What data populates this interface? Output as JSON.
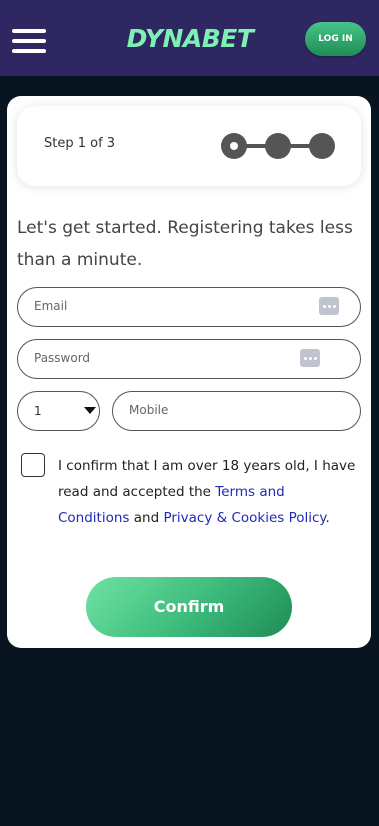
{
  "header": {
    "logo_text": "DYNABET",
    "login_label": "LOG IN"
  },
  "step": {
    "label": "Step 1 of 3",
    "current": 1,
    "total": 3
  },
  "intro_text": "Let's get started. Registering takes less than a minute.",
  "form": {
    "email_placeholder": "Email",
    "password_placeholder": "Password",
    "country_code_value": "1",
    "mobile_placeholder": "Mobile"
  },
  "consent": {
    "text_part1": "I confirm that I am over 18 years old, I have read and accepted the ",
    "terms_link": "Terms and Conditions",
    "text_part2": " and ",
    "privacy_link": "Privacy & Cookies Policy",
    "text_part3": "."
  },
  "confirm_label": "Confirm",
  "colors": {
    "header_bg": "#2e2762",
    "page_bg": "#08141f",
    "logo": "#7ef0b3",
    "accent_green": "#3cb97a",
    "link": "#1f2bb5"
  }
}
